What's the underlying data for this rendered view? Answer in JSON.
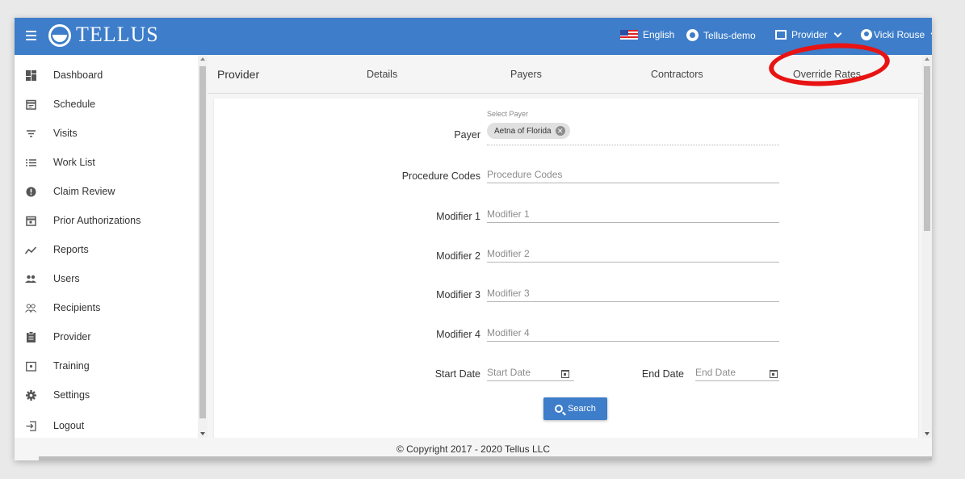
{
  "app": {
    "logo_text": "TELLUS"
  },
  "topbar": {
    "language": "English",
    "tenant": "Tellus-demo",
    "role": "Provider",
    "user": "Vicki Rouse"
  },
  "sidebar": {
    "items": [
      {
        "label": "Dashboard",
        "icon": "dashboard-icon"
      },
      {
        "label": "Schedule",
        "icon": "schedule-icon"
      },
      {
        "label": "Visits",
        "icon": "filter-icon"
      },
      {
        "label": "Work List",
        "icon": "list-icon"
      },
      {
        "label": "Claim Review",
        "icon": "alert-icon"
      },
      {
        "label": "Prior Authorizations",
        "icon": "calendar-icon"
      },
      {
        "label": "Reports",
        "icon": "trend-icon"
      },
      {
        "label": "Users",
        "icon": "users-icon"
      },
      {
        "label": "Recipients",
        "icon": "people-outline-icon"
      },
      {
        "label": "Provider",
        "icon": "clipboard-icon"
      },
      {
        "label": "Training",
        "icon": "training-icon"
      },
      {
        "label": "Settings",
        "icon": "gear-icon"
      },
      {
        "label": "Logout",
        "icon": "logout-icon"
      }
    ]
  },
  "tabs": {
    "section_title": "Provider",
    "details": "Details",
    "payers": "Payers",
    "contractors": "Contractors",
    "override_rates": "Override Rates"
  },
  "form": {
    "payer_hint": "Select Payer",
    "payer_label": "Payer",
    "payer_value": "Aetna of Florida",
    "procedure_label": "Procedure Codes",
    "procedure_placeholder": "Procedure Codes",
    "modifier1_label": "Modifier 1",
    "modifier1_placeholder": "Modifier 1",
    "modifier2_label": "Modifier 2",
    "modifier2_placeholder": "Modifier 2",
    "modifier3_label": "Modifier 3",
    "modifier3_placeholder": "Modifier 3",
    "modifier4_label": "Modifier 4",
    "modifier4_placeholder": "Modifier 4",
    "start_date_label": "Start Date",
    "start_date_placeholder": "Start Date",
    "end_date_label": "End Date",
    "end_date_placeholder": "End Date",
    "search_label": "Search"
  },
  "footer": {
    "copyright": "© Copyright 2017 - 2020 Tellus LLC"
  },
  "colors": {
    "brand_blue": "#3d7dc9",
    "highlight_red": "#e81313"
  }
}
